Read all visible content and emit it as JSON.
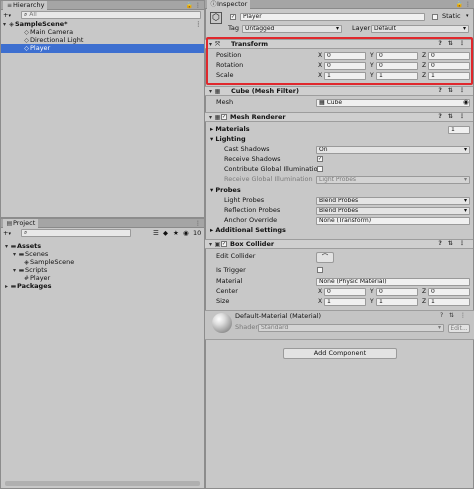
{
  "hierarchy": {
    "tab": "Hierarchy",
    "add_icon": "+",
    "search_placeholder": "All",
    "scene": "SampleScene*",
    "items": [
      "Main Camera",
      "Directional Light",
      "Player"
    ]
  },
  "project": {
    "tab": "Project",
    "count": "10",
    "tree": {
      "assets": "Assets",
      "scenes": "Scenes",
      "sample_scene": "SampleScene",
      "scripts": "Scripts",
      "player": "Player",
      "packages": "Packages"
    }
  },
  "inspector": {
    "tab": "Inspector",
    "object_name": "Player",
    "static_label": "Static",
    "tag_label": "Tag",
    "tag_value": "Untagged",
    "layer_label": "Layer",
    "layer_value": "Default",
    "transform": {
      "title": "Transform",
      "rows": [
        {
          "label": "Position",
          "x": "0",
          "y": "0",
          "z": "0"
        },
        {
          "label": "Rotation",
          "x": "0",
          "y": "0",
          "z": "0"
        },
        {
          "label": "Scale",
          "x": "1",
          "y": "1",
          "z": "1"
        }
      ],
      "highlight_color": "#e0282d"
    },
    "mesh_filter": {
      "title": "Cube (Mesh Filter)",
      "mesh_label": "Mesh",
      "mesh_value": "Cube"
    },
    "mesh_renderer": {
      "title": "Mesh Renderer",
      "materials_label": "Materials",
      "materials_count": "1",
      "lighting_label": "Lighting",
      "cast_shadows_label": "Cast Shadows",
      "cast_shadows_value": "On",
      "receive_shadows_label": "Receive Shadows",
      "contribute_gi_label": "Contribute Global Illumination",
      "receive_gi_label": "Receive Global Illumination",
      "receive_gi_value": "Light Probes",
      "probes_label": "Probes",
      "light_probes_label": "Light Probes",
      "light_probes_value": "Blend Probes",
      "reflection_probes_label": "Reflection Probes",
      "reflection_probes_value": "Blend Probes",
      "anchor_override_label": "Anchor Override",
      "anchor_override_value": "None (Transform)",
      "additional_settings_label": "Additional Settings"
    },
    "box_collider": {
      "title": "Box Collider",
      "edit_collider_label": "Edit Collider",
      "is_trigger_label": "Is Trigger",
      "material_label": "Material",
      "material_value": "None (Physic Material)",
      "center_label": "Center",
      "center": {
        "x": "0",
        "y": "0",
        "z": "0"
      },
      "size_label": "Size",
      "size": {
        "x": "1",
        "y": "1",
        "z": "1"
      }
    },
    "material": {
      "title": "Default-Material (Material)",
      "shader_label": "Shader",
      "shader_value": "Standard",
      "edit_label": "Edit..."
    },
    "add_component_label": "Add Component"
  },
  "icons": {
    "menu": "⋮",
    "lock": "🔒",
    "help": "?",
    "settings": "⇅"
  }
}
